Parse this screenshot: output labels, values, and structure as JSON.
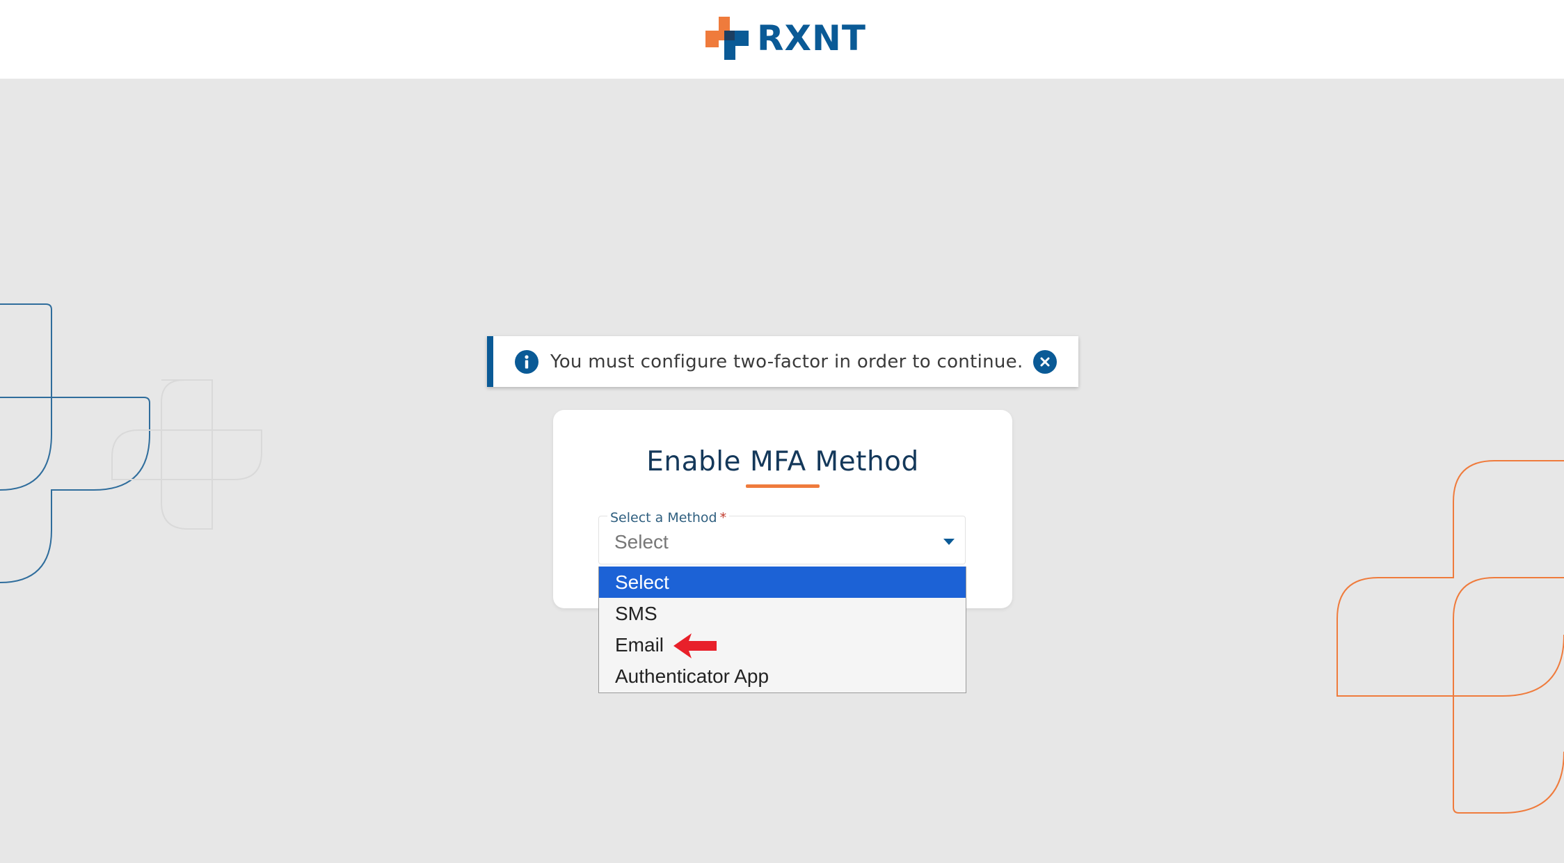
{
  "header": {
    "logo_text": "RXNT"
  },
  "alert": {
    "message": "You must configure two-factor in order to continue."
  },
  "card": {
    "title": "Enable MFA Method"
  },
  "method_field": {
    "label": "Select a Method",
    "required_marker": "*",
    "value": "Select"
  },
  "dropdown": {
    "options": [
      "Select",
      "SMS",
      "Email",
      "Authenticator App"
    ],
    "highlighted": "Select"
  },
  "colors": {
    "brand_blue": "#0a5a96",
    "brand_orange": "#ef7b3c",
    "highlight_blue": "#1c62d6",
    "annotation_red": "#e8202a",
    "background_gray": "#e7e7e7"
  },
  "icons": {
    "logo": "rxnt-cross-logo-icon",
    "alert_info": "info-icon",
    "alert_close": "close-icon",
    "field_caret": "caret-down-icon",
    "annotation": "red-arrow-icon"
  }
}
